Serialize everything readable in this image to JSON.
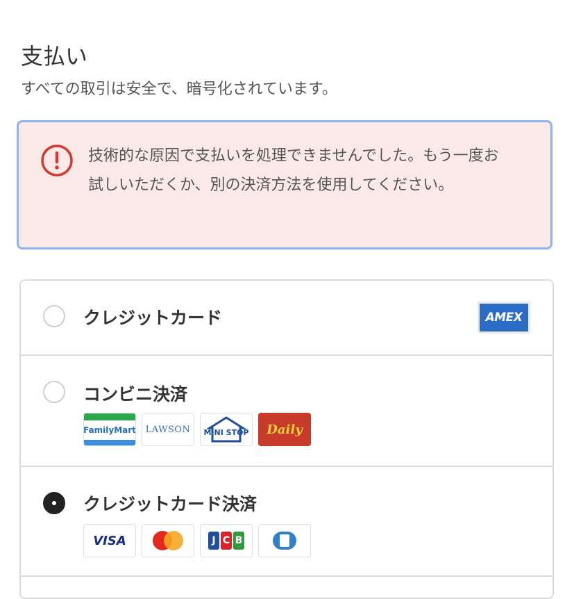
{
  "header": {
    "title": "支払い",
    "subtitle": "すべての取引は安全で、暗号化されています。"
  },
  "alert": {
    "icon": "exclamation-circle-icon",
    "color": "#d23b30",
    "message": "技術的な原因で支払いを処理できませんでした。もう一度お試しいただくか、別の決済方法を使用してください。"
  },
  "payment_methods": [
    {
      "label": "クレジットカード",
      "selected": false,
      "logos": [
        "AMEX"
      ]
    },
    {
      "label": "コンビニ決済",
      "selected": false,
      "logos": [
        "FamilyMart",
        "LAWSON",
        "MINI STOP",
        "Daily"
      ]
    },
    {
      "label": "クレジットカード決済",
      "selected": true,
      "logos": [
        "VISA",
        "mastercard-icon",
        "JCB",
        "diners-club-icon"
      ]
    }
  ]
}
